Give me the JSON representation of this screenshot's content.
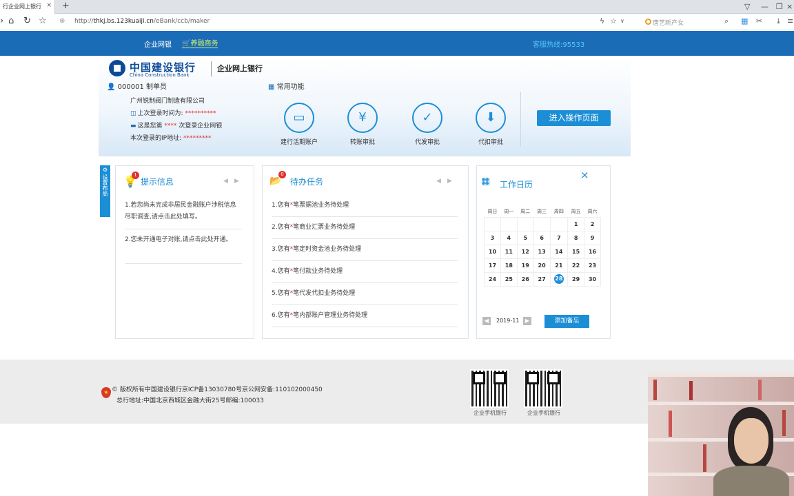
{
  "browser": {
    "tab_title": "行企业网上银行",
    "url_prefix": "http://",
    "url_host": "thkj.bs.123kuaiji.cn",
    "url_path": "/eBank/ccb/maker",
    "search_placeholder": "唐艺昕产女"
  },
  "topnav": {
    "corp_ebank": "企业网银",
    "finance": "养融商务",
    "hotline": "客服热线:95533"
  },
  "header": {
    "bank_cn": "中国建设银行",
    "bank_en": "China Construction Bank",
    "ebank": "企业网上银行",
    "user": "000001 制单员",
    "company": "广州锐制阀门制造有限公司",
    "last_login_label": "上次登录时间为:",
    "last_login_value": "**********",
    "login_count_prefix": "这是您第",
    "login_count_value": "****",
    "login_count_suffix": "次登录企业网银",
    "ip_label": "本次登录的IP地址:",
    "ip_value": "*********",
    "common_functions": "常用功能",
    "functions": [
      {
        "label": "建行活期账户",
        "icon": "card-icon"
      },
      {
        "label": "转账审批",
        "icon": "yuan-icon"
      },
      {
        "label": "代发审批",
        "icon": "check-icon"
      },
      {
        "label": "代扣审批",
        "icon": "download-money-icon"
      }
    ],
    "enter_button": "进入操作页面"
  },
  "sidetab": {
    "label": "设置布局"
  },
  "tips": {
    "title": "提示信息",
    "badge": "1",
    "items": [
      "1.若您尚未完成非居民金融账户涉税信息尽职调查,请点击此处填写。",
      "2.您未开通电子对账,请点击此处开通。"
    ]
  },
  "todo": {
    "title": "待办任务",
    "badge": "0",
    "star": "*",
    "items": [
      {
        "prefix": "1.您有",
        "suffix": "笔票据池业务待处理"
      },
      {
        "prefix": "2.您有",
        "suffix": "笔商业汇票业务待处理"
      },
      {
        "prefix": "3.您有",
        "suffix": "笔定时资金池业务待处理"
      },
      {
        "prefix": "4.您有",
        "suffix": "笔付款业务待处理"
      },
      {
        "prefix": "5.您有",
        "suffix": "笔代发代扣业务待处理"
      },
      {
        "prefix": "6.您有",
        "suffix": "笔内部账户管理业务待处理"
      }
    ]
  },
  "calendar": {
    "title": "工作日历",
    "weekdays": [
      "周日",
      "周一",
      "周二",
      "周三",
      "周四",
      "周五",
      "周六"
    ],
    "weeks": [
      [
        "",
        "",
        "",
        "",
        "",
        "1",
        "2"
      ],
      [
        "3",
        "4",
        "5",
        "6",
        "7",
        "8",
        "9"
      ],
      [
        "10",
        "11",
        "12",
        "13",
        "14",
        "15",
        "16"
      ],
      [
        "17",
        "18",
        "19",
        "20",
        "21",
        "22",
        "23"
      ],
      [
        "24",
        "25",
        "26",
        "27",
        "28",
        "29",
        "30"
      ]
    ],
    "today": "28",
    "month": "2019-11",
    "add_note": "添加备忘"
  },
  "footer": {
    "copyright": "© 版权所有中国建设银行京ICP备13030780号京公网安备:110102000450",
    "address": "总行地址:中国北京西城区金融大街25号邮编:100033",
    "qr1_caption": "企业手机银行",
    "qr2_caption": "企业手机银行"
  },
  "colors": {
    "brand_blue": "#1b6cb7",
    "accent": "#1b8ed6",
    "alert": "#e03030"
  }
}
